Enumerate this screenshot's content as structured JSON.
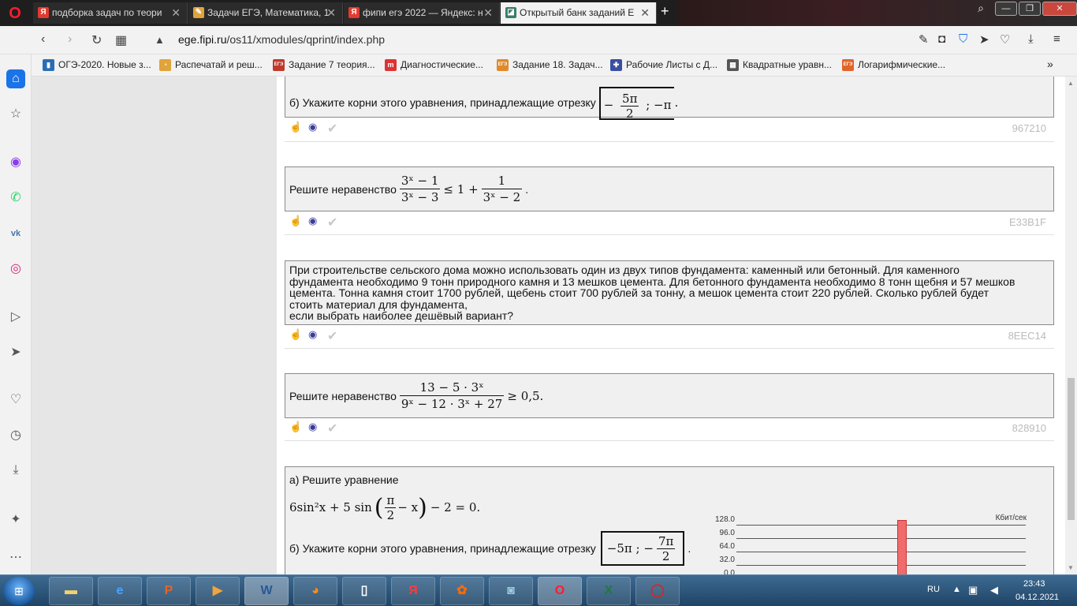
{
  "browser": {
    "tabs": [
      {
        "label": "подборка задач по теори",
        "favicon": "Я",
        "color": "#e23b2f"
      },
      {
        "label": "Задачи ЕГЭ, Математика, 1",
        "favicon": "✎",
        "color": "#e0a43a"
      },
      {
        "label": "фипи егэ 2022 — Яндекс: н",
        "favicon": "Я",
        "color": "#e23b2f"
      },
      {
        "label": "Открытый банк заданий Е",
        "favicon": "◪",
        "color": "#3a7d6a"
      }
    ],
    "url_domain": "ege.fipi.ru",
    "url_path": "/os11/xmodules/qprint/index.php",
    "bookmarks": [
      {
        "label": "ОГЭ-2020. Новые з...",
        "icon": "▮",
        "color": "#2a6db5"
      },
      {
        "label": "Распечатай и реш...",
        "icon": "◔",
        "color": "#e0a43a"
      },
      {
        "label": "Задание 7 теория...",
        "icon": "ЕГЭ",
        "color": "#c0392b"
      },
      {
        "label": "Диагностические...",
        "icon": "m",
        "color": "#d33"
      },
      {
        "label": "Задание 18. Задач...",
        "icon": "ЕГЭ",
        "color": "#e08a2a"
      },
      {
        "label": "Рабочие Листы с Д...",
        "icon": "✚",
        "color": "#3a4fa0"
      },
      {
        "label": "Квадратные уравн...",
        "icon": "▦",
        "color": "#555"
      },
      {
        "label": "Логарифмические...",
        "icon": "ЕГЭ",
        "color": "#e0662a"
      }
    ]
  },
  "tasks": [
    {
      "text": "б) Укажите корни этого уравнения, принадлежащие отрезку",
      "segment_left": "−",
      "segment_num": "5π",
      "segment_den": "2",
      "segment_right": "; −π",
      "code": "967210"
    },
    {
      "text": "Решите неравенство",
      "lhs_num": "3ˣ − 1",
      "lhs_den": "3ˣ − 3",
      "rel": "≤ 1 +",
      "rhs_num": "1",
      "rhs_den": "3ˣ − 2",
      "code": "E33B1F"
    },
    {
      "lines": [
        "При строительстве сельского дома можно использовать один из двух типов фундамента: каменный или бетонный. Для каменного",
        "фундамента необходимо 9 тонн природного камня и 13 мешков цемента. Для бетонного фундамента необходимо 8 тонн щебня и 57 мешков",
        "цемента. Тонна камня стоит 1700 рублей, щебень стоит 700 рублей за тонну, а мешок цемента стоит 220 рублей. Сколько рублей будет",
        "стоить материал для фундамента,",
        "если выбрать наиболее дешёвый вариант?"
      ],
      "code": "8EEC14"
    },
    {
      "text": "Решите неравенство",
      "num": "13 − 5 · 3ˣ",
      "den": "9ˣ − 12 · 3ˣ + 27",
      "rel": "≥ 0,5.",
      "code": "828910"
    },
    {
      "part_a": "а) Решите уравнение",
      "equation_left": "6sin²x + 5 sin",
      "paren_num": "π",
      "paren_den": "2",
      "paren_rest": "− x",
      "equation_right": "− 2 = 0.",
      "part_b": "б) Укажите корни этого уравнения, принадлежащие отрезку",
      "seg_left": "−5π ;  −",
      "seg_num": "7π",
      "seg_den": "2"
    }
  ],
  "net_widget": {
    "unit": "Кбит/сек",
    "labels": [
      "128.0",
      "96.0",
      "64.0",
      "32.0",
      "0.0"
    ]
  },
  "taskbar": {
    "lang": "RU",
    "time": "23:43",
    "date": "04.12.2021"
  }
}
